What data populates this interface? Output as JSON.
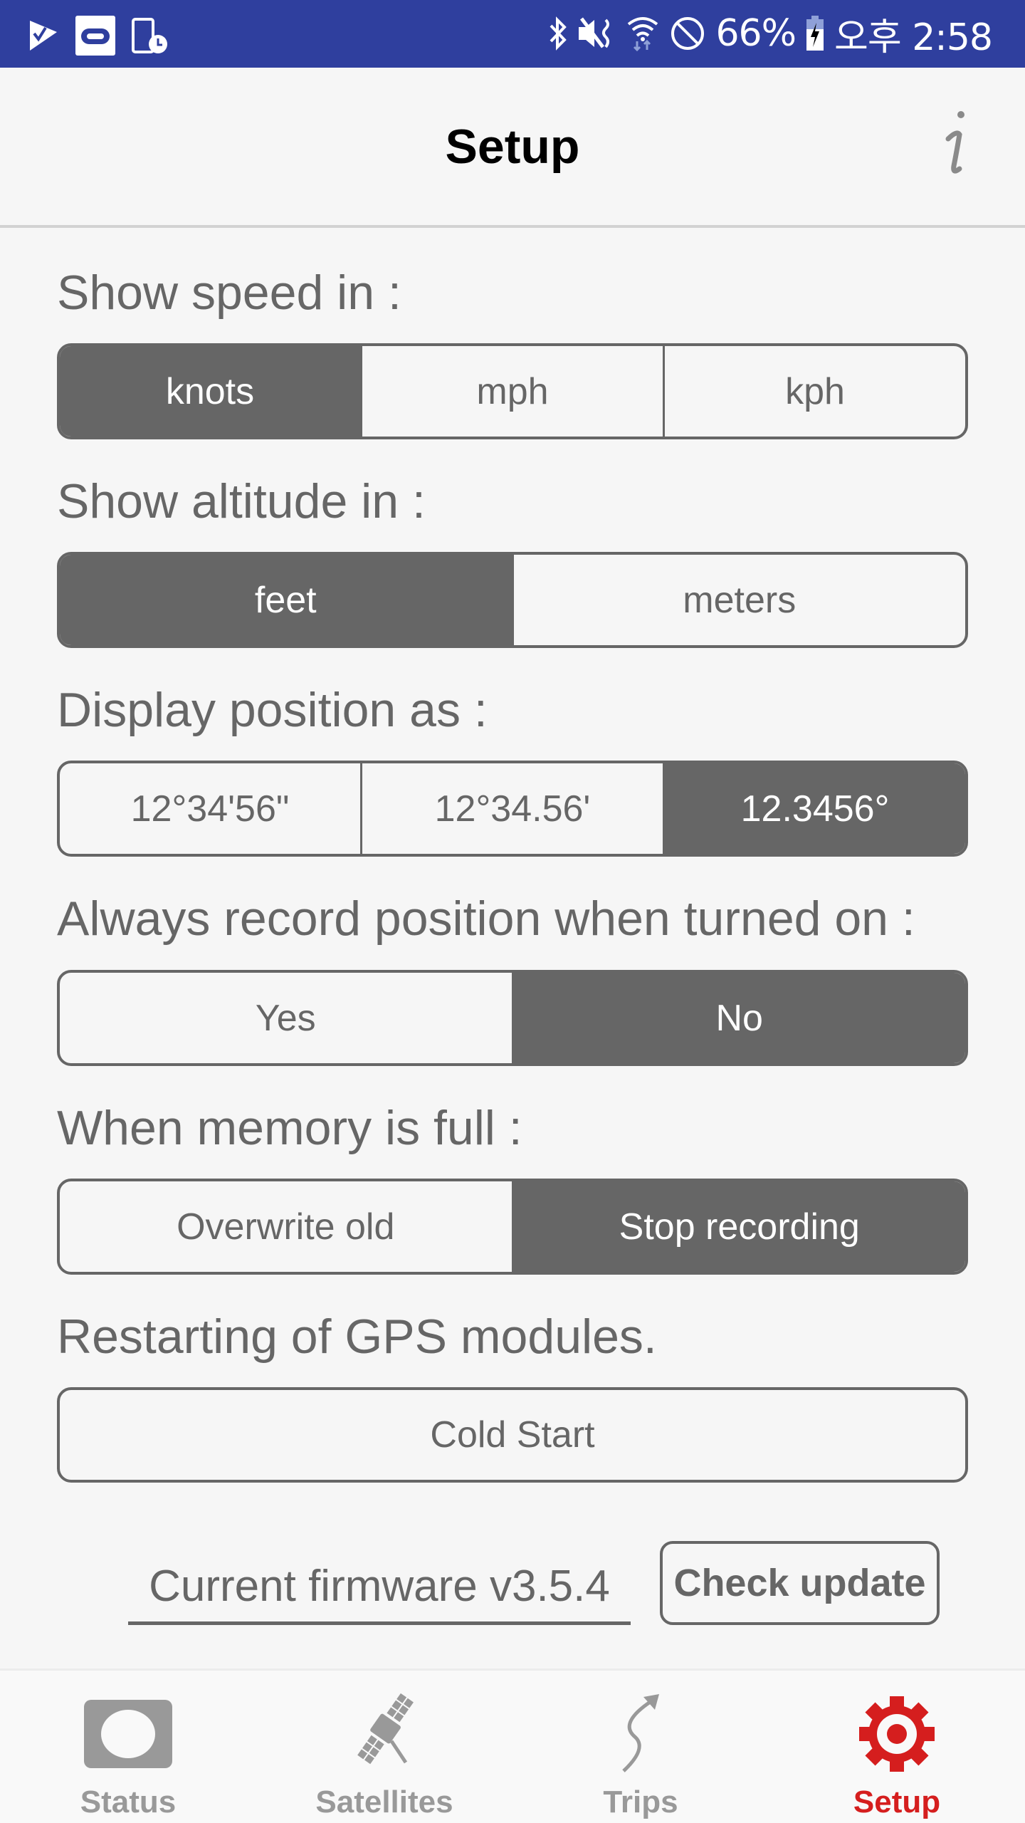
{
  "status_bar": {
    "left_icons": [
      "task-check-icon",
      "notification-app-icon",
      "device-clock-icon"
    ],
    "right_icons": [
      "bluetooth-icon",
      "vibrate-mute-icon",
      "wifi-data-icon",
      "do-not-disturb-icon",
      "battery-charging-icon"
    ],
    "battery": "66%",
    "time": "오후 2:58",
    "background_color": "#2f3f9e"
  },
  "header": {
    "title": "Setup",
    "info_icon": "info-icon"
  },
  "sections": [
    {
      "label": "Show speed in :",
      "options": [
        "knots",
        "mph",
        "kph"
      ],
      "selected": "knots"
    },
    {
      "label": "Show altitude in :",
      "options": [
        "feet",
        "meters"
      ],
      "selected": "feet"
    },
    {
      "label": "Display position as :",
      "options": [
        "12°34'56\"",
        "12°34.56'",
        "12.3456°"
      ],
      "selected": "12.3456°"
    },
    {
      "label": "Always record position when turned on :",
      "options": [
        "Yes",
        "No"
      ],
      "selected": "No"
    },
    {
      "label": "When memory is full :",
      "options": [
        "Overwrite old",
        "Stop recording"
      ],
      "selected": "Stop recording"
    }
  ],
  "restart": {
    "label": "Restarting of GPS modules.",
    "button": "Cold Start"
  },
  "firmware": {
    "text": "Current firmware v3.5.4",
    "button": "Check update"
  },
  "bottom_nav": {
    "items": [
      {
        "label": "Status",
        "icon": "status-icon",
        "active": false
      },
      {
        "label": "Satellites",
        "icon": "satellite-icon",
        "active": false
      },
      {
        "label": "Trips",
        "icon": "trips-icon",
        "active": false
      },
      {
        "label": "Setup",
        "icon": "gear-icon",
        "active": true
      }
    ],
    "active_color": "#d51e1e",
    "inactive_color": "#999999"
  },
  "colors": {
    "selected_segment": "#666666",
    "background": "#f6f6f6"
  }
}
